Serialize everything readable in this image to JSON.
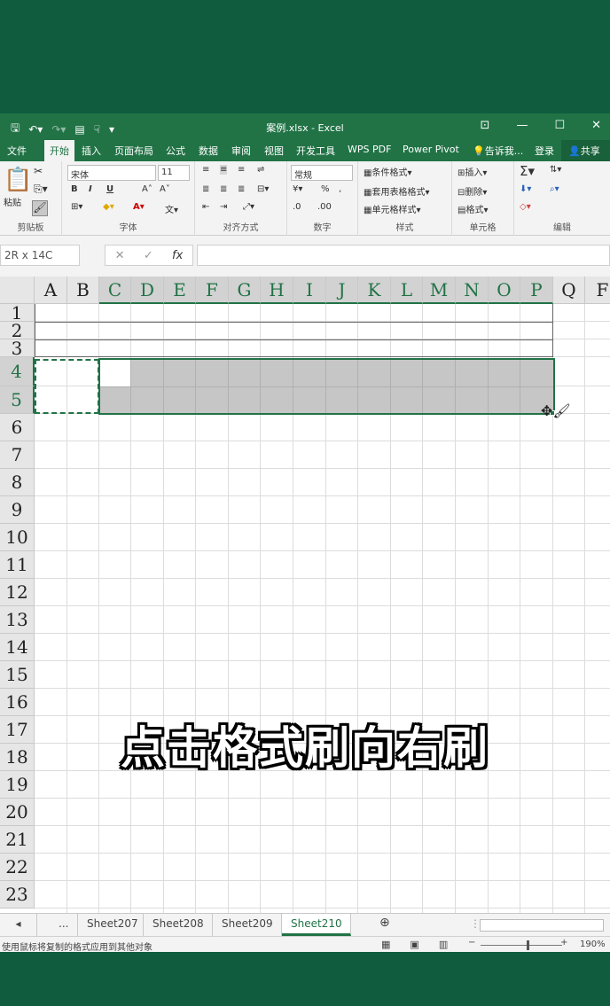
{
  "title_bar": {
    "doc_title": "案例.xlsx - Excel",
    "qat_icons": [
      "save-icon",
      "undo-icon",
      "redo-icon",
      "form-icon",
      "touch-icon",
      "customize-icon"
    ]
  },
  "tabs": [
    "文件",
    "开始",
    "插入",
    "页面布局",
    "公式",
    "数据",
    "审阅",
    "视图",
    "开发工具",
    "WPS PDF",
    "Power Pivot",
    "告诉我...",
    "登录"
  ],
  "tab_active": "开始",
  "share_label": "共享",
  "ribbon": {
    "clipboard": {
      "paste": "粘贴",
      "label": "剪贴板"
    },
    "font": {
      "name": "宋体",
      "size": "11",
      "bold": "B",
      "italic": "I",
      "underline": "U",
      "label": "字体"
    },
    "alignment": {
      "label": "对齐方式"
    },
    "number": {
      "format": "常规",
      "label": "数字"
    },
    "styles": {
      "cond": "条件格式",
      "table": "套用表格格式",
      "cell": "单元格样式",
      "label": "样式"
    },
    "cells": {
      "insert": "插入",
      "delete": "删除",
      "format": "格式",
      "label": "单元格"
    },
    "editing": {
      "label": "编辑"
    }
  },
  "formula_bar": {
    "name_box": "2R x 14C",
    "fx": "fx",
    "cancel": "✕",
    "enter": "✓",
    "value": ""
  },
  "columns": [
    "A",
    "B",
    "C",
    "D",
    "E",
    "F",
    "G",
    "H",
    "I",
    "J",
    "K",
    "L",
    "M",
    "N",
    "O",
    "P",
    "Q",
    "F"
  ],
  "rows": [
    "1",
    "2",
    "3",
    "4",
    "5",
    "6",
    "7",
    "8",
    "9",
    "10",
    "11",
    "12",
    "13",
    "14",
    "15",
    "16",
    "17",
    "18",
    "19",
    "20",
    "21",
    "22",
    "23"
  ],
  "overlay_caption": "点击格式刷向右刷",
  "sheet_tabs": {
    "more": "...",
    "tabs": [
      "Sheet207",
      "Sheet208",
      "Sheet209",
      "Sheet210"
    ],
    "active": "Sheet210"
  },
  "status_bar": {
    "message": "使用鼠标将复制的格式应用到其他对象",
    "zoom": "190%"
  },
  "colors": {
    "excel_green": "#217346",
    "background_green": "#0f5c3e",
    "selection_gray": "#c6c6c6"
  }
}
